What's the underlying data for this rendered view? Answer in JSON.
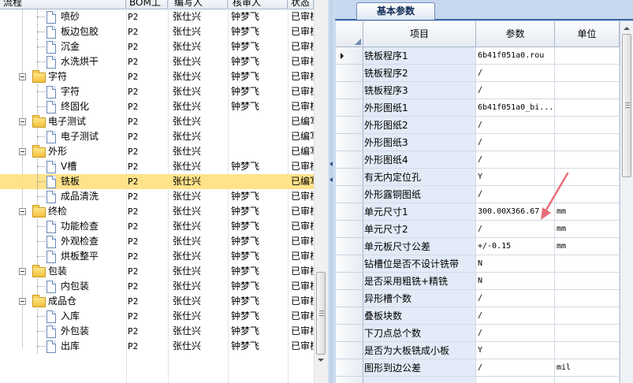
{
  "tree_columns": {
    "flow": "流程",
    "bom": "BOM工",
    "maker": "编写人",
    "auditor": "核审人",
    "status": "状态"
  },
  "tree_rows": [
    {
      "label": "喷砂",
      "kind": "leaf",
      "level": 2,
      "bom": "P2",
      "maker": "张仕兴",
      "auditor": "钟梦飞",
      "status": "已审核"
    },
    {
      "label": "板边包胶",
      "kind": "leaf",
      "level": 2,
      "bom": "P2",
      "maker": "张仕兴",
      "auditor": "钟梦飞",
      "status": "已审核"
    },
    {
      "label": "沉金",
      "kind": "leaf",
      "level": 2,
      "bom": "P2",
      "maker": "张仕兴",
      "auditor": "钟梦飞",
      "status": "已审核"
    },
    {
      "label": "水洗烘干",
      "kind": "leaf",
      "level": 2,
      "bom": "P2",
      "maker": "张仕兴",
      "auditor": "钟梦飞",
      "status": "已审核"
    },
    {
      "label": "字符",
      "kind": "folder",
      "level": 1,
      "bom": "P2",
      "maker": "张仕兴",
      "auditor": "钟梦飞",
      "status": "已审核"
    },
    {
      "label": "字符",
      "kind": "leaf",
      "level": 2,
      "bom": "P2",
      "maker": "张仕兴",
      "auditor": "钟梦飞",
      "status": "已审核"
    },
    {
      "label": "终固化",
      "kind": "leaf",
      "level": 2,
      "bom": "P2",
      "maker": "张仕兴",
      "auditor": "钟梦飞",
      "status": "已审核"
    },
    {
      "label": "电子测试",
      "kind": "folder",
      "level": 1,
      "bom": "P2",
      "maker": "张仕兴",
      "auditor": "",
      "status": "已编写"
    },
    {
      "label": "电子测试",
      "kind": "leaf",
      "level": 2,
      "bom": "P2",
      "maker": "张仕兴",
      "auditor": "",
      "status": "已编写"
    },
    {
      "label": "外形",
      "kind": "folder",
      "level": 1,
      "bom": "P2",
      "maker": "张仕兴",
      "auditor": "",
      "status": "已编写"
    },
    {
      "label": "V槽",
      "kind": "leaf",
      "level": 2,
      "bom": "P2",
      "maker": "张仕兴",
      "auditor": "钟梦飞",
      "status": "已审核"
    },
    {
      "label": "铣板",
      "kind": "leaf",
      "level": 2,
      "bom": "P2",
      "maker": "张仕兴",
      "auditor": "",
      "status": "已编写",
      "selected": true
    },
    {
      "label": "成品清洗",
      "kind": "leaf",
      "level": 2,
      "bom": "P2",
      "maker": "张仕兴",
      "auditor": "钟梦飞",
      "status": "已审核"
    },
    {
      "label": "终检",
      "kind": "folder",
      "level": 1,
      "bom": "P2",
      "maker": "张仕兴",
      "auditor": "钟梦飞",
      "status": "已审核"
    },
    {
      "label": "功能检查",
      "kind": "leaf",
      "level": 2,
      "bom": "P2",
      "maker": "张仕兴",
      "auditor": "钟梦飞",
      "status": "已审核"
    },
    {
      "label": "外观检查",
      "kind": "leaf",
      "level": 2,
      "bom": "P2",
      "maker": "张仕兴",
      "auditor": "钟梦飞",
      "status": "已审核"
    },
    {
      "label": "烘板整平",
      "kind": "leaf",
      "level": 2,
      "bom": "P2",
      "maker": "张仕兴",
      "auditor": "钟梦飞",
      "status": "已审核"
    },
    {
      "label": "包装",
      "kind": "folder",
      "level": 1,
      "bom": "P2",
      "maker": "张仕兴",
      "auditor": "钟梦飞",
      "status": "已审核"
    },
    {
      "label": "内包装",
      "kind": "leaf",
      "level": 2,
      "bom": "P2",
      "maker": "张仕兴",
      "auditor": "钟梦飞",
      "status": "已审核"
    },
    {
      "label": "成品仓",
      "kind": "folder",
      "level": 1,
      "bom": "P2",
      "maker": "张仕兴",
      "auditor": "钟梦飞",
      "status": "已审核"
    },
    {
      "label": "入库",
      "kind": "leaf",
      "level": 2,
      "bom": "P2",
      "maker": "张仕兴",
      "auditor": "钟梦飞",
      "status": "已审核"
    },
    {
      "label": "外包装",
      "kind": "leaf",
      "level": 2,
      "bom": "P2",
      "maker": "张仕兴",
      "auditor": "钟梦飞",
      "status": "已审核"
    },
    {
      "label": "出库",
      "kind": "leaf",
      "level": 2,
      "bom": "P2",
      "maker": "张仕兴",
      "auditor": "钟梦飞",
      "status": "已审核"
    }
  ],
  "tab": {
    "label": "基本参数"
  },
  "grid_columns": {
    "item": "项目",
    "param": "参数",
    "unit": "单位"
  },
  "grid_rows": [
    {
      "item": "铣板程序1",
      "param": "6b41f051a0.rou",
      "unit": "",
      "current": true
    },
    {
      "item": "铣板程序2",
      "param": "/",
      "unit": ""
    },
    {
      "item": "铣板程序3",
      "param": "/",
      "unit": ""
    },
    {
      "item": "外形图纸1",
      "param": "6b41f051a0_bi...",
      "unit": ""
    },
    {
      "item": "外形图纸2",
      "param": "/",
      "unit": ""
    },
    {
      "item": "外形图纸3",
      "param": "/",
      "unit": ""
    },
    {
      "item": "外形图纸4",
      "param": "/",
      "unit": ""
    },
    {
      "item": "有无内定位孔",
      "param": "Y",
      "unit": ""
    },
    {
      "item": "外形露铜图纸",
      "param": "/",
      "unit": ""
    },
    {
      "item": "单元尺寸1",
      "param": "300.00X366.67",
      "unit": "mm"
    },
    {
      "item": "单元尺寸2",
      "param": "/",
      "unit": "mm"
    },
    {
      "item": "单元板尺寸公差",
      "param": "+/-0.15",
      "unit": "mm"
    },
    {
      "item": "钻槽位是否不设计铣带",
      "param": "N",
      "unit": ""
    },
    {
      "item": "是否采用粗铣+精铣",
      "param": "N",
      "unit": ""
    },
    {
      "item": "异形槽个数",
      "param": "/",
      "unit": ""
    },
    {
      "item": "叠板块数",
      "param": "/",
      "unit": ""
    },
    {
      "item": "下刀点总个数",
      "param": "/",
      "unit": ""
    },
    {
      "item": "是否为大板铣成小板",
      "param": "Y",
      "unit": ""
    },
    {
      "item": "图形到边公差",
      "param": "/",
      "unit": "mil"
    },
    {
      "item": "",
      "param": "",
      "unit": ""
    }
  ],
  "colors": {
    "selection": "#ffe28a",
    "item_column_bg": "#e2ebf7",
    "tab_bar": "#c7d7ee",
    "annotation_arrow": "#e8707a"
  },
  "icons": {
    "folder": "folder-icon",
    "leaf": "page-icon",
    "expander": "collapse-icon",
    "row_pointer": "current-row-arrow-icon"
  }
}
